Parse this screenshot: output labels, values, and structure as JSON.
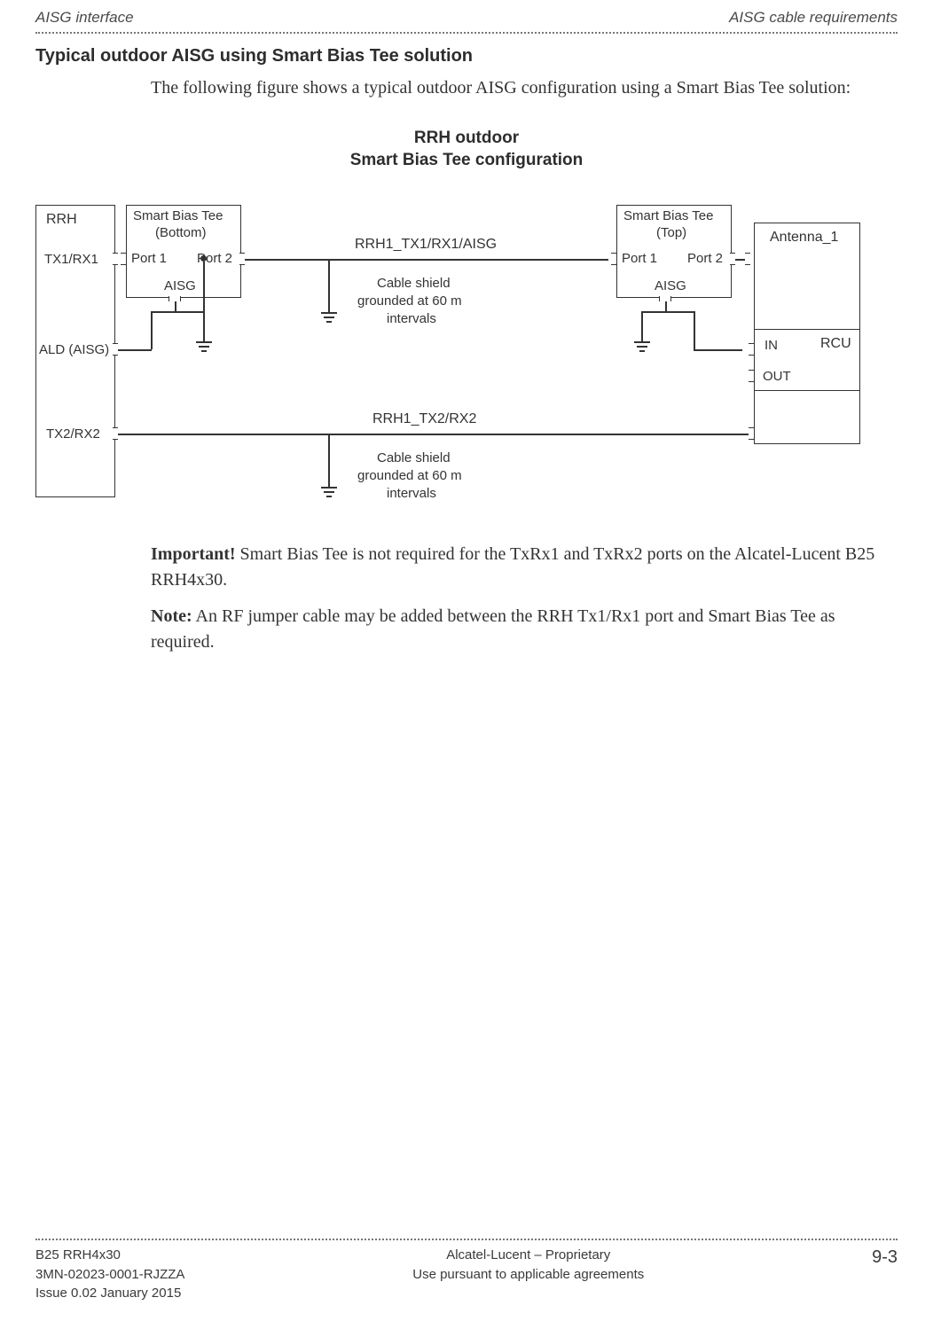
{
  "header": {
    "left": "AISG interface",
    "right": "AISG cable requirements"
  },
  "section_title": "Typical outdoor AISG using Smart Bias Tee solution",
  "intro": "The following figure shows a typical outdoor AISG configuration using a Smart Bias Tee solution:",
  "figure": {
    "caption_line1": "RRH outdoor",
    "caption_line2": "Smart Bias Tee configuration",
    "rrh": "RRH",
    "tx1rx1": "TX1/RX1",
    "ald_aisg": "ALD (AISG)",
    "tx2rx2": "TX2/RX2",
    "sbt_bottom_line1": "Smart Bias Tee",
    "sbt_bottom_line2": "(Bottom)",
    "port1": "Port 1",
    "port2": "Port 2",
    "aisg": "AISG",
    "cable1": "RRH1_TX1/RX1/AISG",
    "cable2": "RRH1_TX2/RX2",
    "shield_line1": "Cable shield",
    "shield_line2": "grounded at 60 m",
    "shield_line3": "intervals",
    "sbt_top_line1": "Smart Bias Tee",
    "sbt_top_line2": "(Top)",
    "antenna": "Antenna_1",
    "rcu": "RCU",
    "in": "IN",
    "out": "OUT"
  },
  "important_label": "Important!",
  "important_text": " Smart Bias Tee is not required for the TxRx1 and TxRx2 ports on the Alcatel-Lucent B25 RRH4x30.",
  "note_label": "Note:",
  "note_text": " An RF jumper cable may be added between the RRH Tx1/Rx1 port and Smart Bias Tee as required.",
  "footer": {
    "left_line1": "B25 RRH4x30",
    "left_line2": "3MN-02023-0001-RJZZA",
    "left_line3": "Issue 0.02   January 2015",
    "center_line1": "Alcatel-Lucent – Proprietary",
    "center_line2": "Use pursuant to applicable agreements",
    "page_number": "9-3"
  }
}
